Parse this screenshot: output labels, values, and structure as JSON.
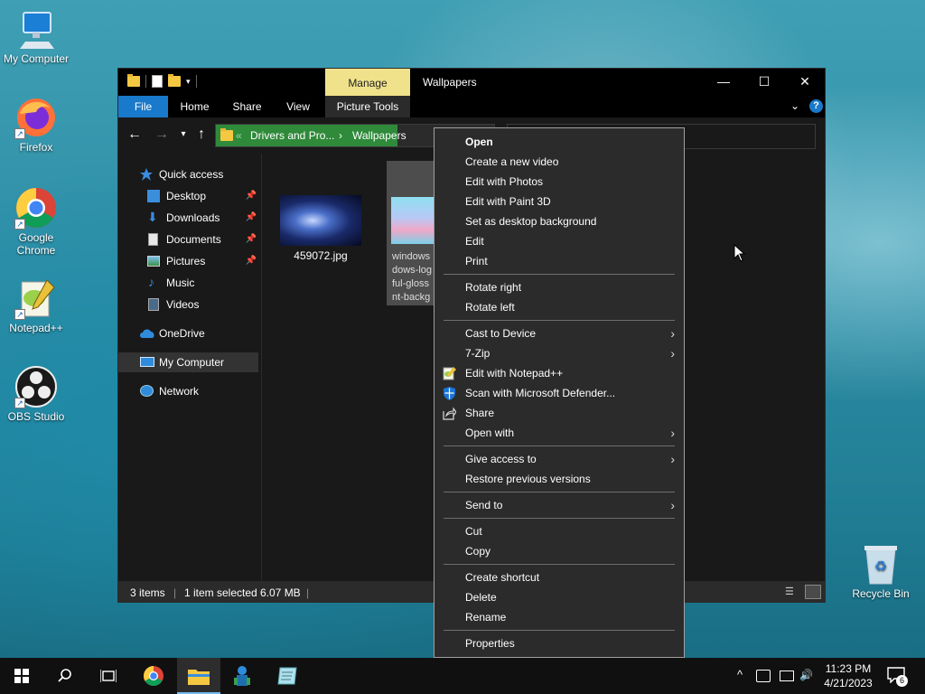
{
  "desktop": {
    "icons": [
      {
        "label": "My Computer",
        "icon": "monitor-icon"
      },
      {
        "label": "Firefox",
        "icon": "firefox-icon"
      },
      {
        "label": "Google Chrome",
        "icon": "chrome-icon"
      },
      {
        "label": "Notepad++",
        "icon": "notepadpp-icon"
      },
      {
        "label": "OBS Studio",
        "icon": "obs-icon"
      }
    ],
    "recycle_bin": "Recycle Bin"
  },
  "window": {
    "title": "Wallpapers",
    "manage_tab": "Manage",
    "controls": {
      "minimize": "—",
      "maximize": "☐",
      "close": "✕"
    },
    "ribbon_tabs": [
      "File",
      "Home",
      "Share",
      "View",
      "Picture Tools"
    ],
    "help_label": "?",
    "address": {
      "sep": "«",
      "crumb1": "Drivers and Pro...",
      "arrow": "›",
      "crumb2": "Wallpapers"
    },
    "nav_pane": [
      {
        "label": "Quick access",
        "icon": "star-icon"
      },
      {
        "label": "Desktop",
        "icon": "desktop-folder-icon",
        "pinned": true
      },
      {
        "label": "Downloads",
        "icon": "download-icon",
        "pinned": true
      },
      {
        "label": "Documents",
        "icon": "document-icon",
        "pinned": true
      },
      {
        "label": "Pictures",
        "icon": "pictures-icon",
        "pinned": true
      },
      {
        "label": "Music",
        "icon": "music-icon"
      },
      {
        "label": "Videos",
        "icon": "videos-icon"
      },
      {
        "label": "OneDrive",
        "icon": "cloud-icon"
      },
      {
        "label": "My Computer",
        "icon": "computer-icon",
        "selected": true
      },
      {
        "label": "Network",
        "icon": "network-icon"
      }
    ],
    "files": [
      {
        "name": "459072.jpg"
      },
      {
        "name_lines": [
          "windows",
          "dows-log",
          "ful-gloss",
          "nt-backg"
        ]
      }
    ],
    "status": {
      "items": "3 items",
      "selected": "1 item selected",
      "size": "6.07 MB"
    }
  },
  "context_menu": {
    "groups": [
      [
        {
          "label": "Open",
          "bold": true
        },
        {
          "label": "Create a new video"
        },
        {
          "label": "Edit with Photos"
        },
        {
          "label": "Edit with Paint 3D"
        },
        {
          "label": "Set as desktop background"
        },
        {
          "label": "Edit"
        },
        {
          "label": "Print"
        }
      ],
      [
        {
          "label": "Rotate right"
        },
        {
          "label": "Rotate left"
        }
      ],
      [
        {
          "label": "Cast to Device",
          "submenu": true
        },
        {
          "label": "7-Zip",
          "submenu": true
        },
        {
          "label": "Edit with Notepad++",
          "icon": "notepadpp-icon"
        },
        {
          "label": "Scan with Microsoft Defender...",
          "icon": "defender-shield-icon"
        },
        {
          "label": "Share",
          "icon": "share-icon"
        },
        {
          "label": "Open with",
          "submenu": true
        }
      ],
      [
        {
          "label": "Give access to",
          "submenu": true
        },
        {
          "label": "Restore previous versions"
        }
      ],
      [
        {
          "label": "Send to",
          "submenu": true
        }
      ],
      [
        {
          "label": "Cut"
        },
        {
          "label": "Copy"
        }
      ],
      [
        {
          "label": "Create shortcut"
        },
        {
          "label": "Delete"
        },
        {
          "label": "Rename"
        }
      ],
      [
        {
          "label": "Properties"
        }
      ]
    ]
  },
  "taskbar": {
    "apps": [
      "start-icon",
      "search-icon",
      "task-view-icon",
      "chrome-icon",
      "file-explorer-icon",
      "network-app-icon",
      "notepad-app-icon"
    ],
    "time": "11:23 PM",
    "date": "4/21/2023",
    "notification_count": "6",
    "tray": {
      "chevron": "^",
      "volume": "🔊"
    }
  },
  "colors": {
    "accent": "#1979ca",
    "manage_tab": "#f0e28a",
    "menu_bg": "#2b2b2b",
    "address_highlight": "#2f8a3a"
  }
}
